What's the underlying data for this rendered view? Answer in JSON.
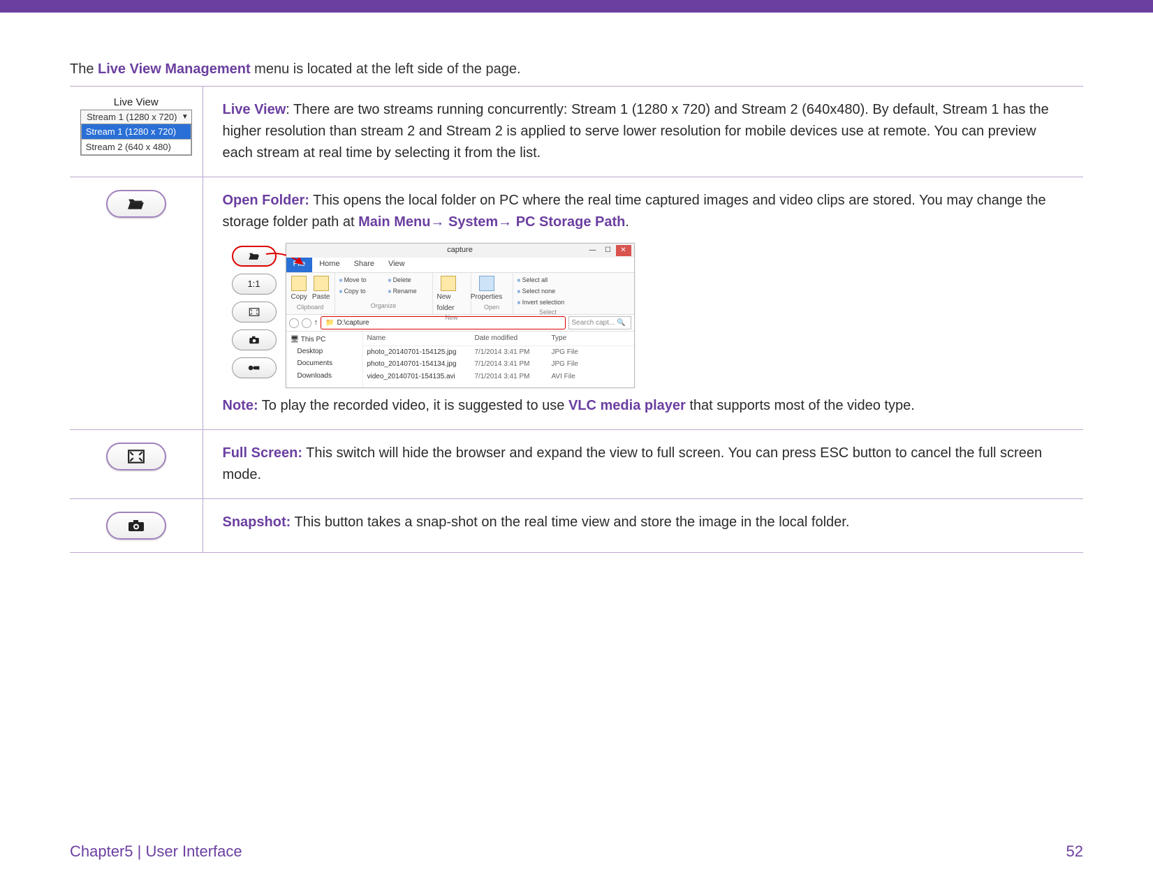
{
  "intro": {
    "pre": "The ",
    "highlight": "Live View Management",
    "post": " menu is located at the left side of the page."
  },
  "row1": {
    "liveview_title": "Live View",
    "dropdown_current": "Stream 1 (1280 x 720)",
    "dropdown_opt_selected": "Stream 1 (1280 x 720)",
    "dropdown_opt_other": "Stream 2 (640 x 480)",
    "label": "Live View",
    "text": ": There are two streams running concurrently: Stream 1 (1280 x 720) and Stream 2 (640x480). By default, Stream 1 has the higher resolution than stream 2 and Stream 2 is applied to serve lower resolution for mobile devices use at remote. You can preview each stream at real time by selecting it from the list."
  },
  "row2": {
    "label": "Open Folder:",
    "text1": " This opens the local folder on PC where the real time captured images and video clips are stored. You may change the storage folder path at ",
    "path1": "Main Menu",
    "arrow": "→",
    "path2": " System",
    "path3": " PC Storage Path",
    "note_label": "Note:",
    "note_text_pre": " To play the recorded video, it is suggested to use ",
    "note_vlc": "VLC media player",
    "note_text_post": " that supports most of the video type."
  },
  "row3": {
    "label": "Full Screen:",
    "text": " This switch will hide the browser and expand the view to full screen. You can press ESC button to cancel the full screen mode."
  },
  "row4": {
    "label": "Snapshot:",
    "text": " This button takes a snap-shot on the real time view and store the image in the local folder."
  },
  "explorer": {
    "title": "capture",
    "tabs": {
      "file": "File",
      "home": "Home",
      "share": "Share",
      "view": "View"
    },
    "ribbon": {
      "copy": "Copy",
      "paste": "Paste",
      "moveto": "Move to",
      "copyto": "Copy to",
      "delete": "Delete",
      "rename": "Rename",
      "newfolder": "New folder",
      "properties": "Properties",
      "selectall": "Select all",
      "selectnone": "Select none",
      "invert": "Invert selection",
      "grp_clip": "Clipboard",
      "grp_org": "Organize",
      "grp_new": "New",
      "grp_open": "Open",
      "grp_sel": "Select"
    },
    "path_text": "D:\\capture",
    "search_placeholder": "Search capt...",
    "tree": {
      "root": "This PC",
      "n1": "Desktop",
      "n2": "Documents",
      "n3": "Downloads"
    },
    "cols": {
      "name": "Name",
      "date": "Date modified",
      "type": "Type"
    },
    "files": [
      {
        "name": "photo_20140701-154125.jpg",
        "date": "7/1/2014 3:41 PM",
        "type": "JPG File"
      },
      {
        "name": "photo_20140701-154134.jpg",
        "date": "7/1/2014 3:41 PM",
        "type": "JPG File"
      },
      {
        "name": "video_20140701-154135.avi",
        "date": "7/1/2014 3:41 PM",
        "type": "AVI File"
      }
    ]
  },
  "sideicons": {
    "i1": "1:1"
  },
  "footer": {
    "left": "Chapter5  |  User Interface",
    "right": "52"
  }
}
